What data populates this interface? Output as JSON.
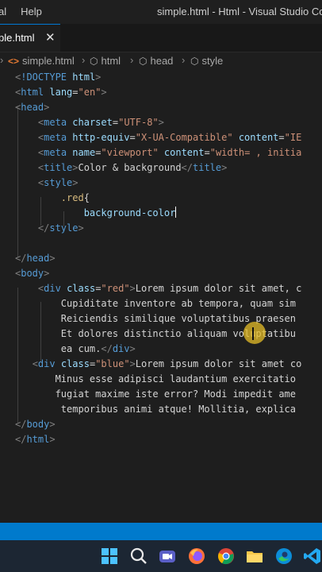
{
  "window": {
    "menu": [
      "al",
      "Help"
    ],
    "title": "simple.html - Html - Visual Studio Code"
  },
  "tab": {
    "label": "ple.html",
    "close": "✕"
  },
  "breadcrumb": [
    "simple.html",
    "html",
    "head",
    "style"
  ],
  "code": [
    [
      [
        "punct",
        "<"
      ],
      [
        "tag",
        "!DOCTYPE"
      ],
      [
        "txt",
        " "
      ],
      [
        "attr",
        "html"
      ],
      [
        "punct",
        ">"
      ]
    ],
    [
      [
        "punct",
        "<"
      ],
      [
        "tag",
        "html"
      ],
      [
        "txt",
        " "
      ],
      [
        "attr",
        "lang"
      ],
      [
        "txt",
        "="
      ],
      [
        "str",
        "\"en\""
      ],
      [
        "punct",
        ">"
      ]
    ],
    [
      [
        "punct",
        "<"
      ],
      [
        "tag",
        "head"
      ],
      [
        "punct",
        ">"
      ]
    ],
    [
      [
        "txt",
        "    "
      ],
      [
        "punct",
        "<"
      ],
      [
        "tag",
        "meta"
      ],
      [
        "txt",
        " "
      ],
      [
        "attr",
        "charset"
      ],
      [
        "txt",
        "="
      ],
      [
        "str",
        "\"UTF-8\""
      ],
      [
        "punct",
        ">"
      ]
    ],
    [
      [
        "txt",
        "    "
      ],
      [
        "punct",
        "<"
      ],
      [
        "tag",
        "meta"
      ],
      [
        "txt",
        " "
      ],
      [
        "attr",
        "http-equiv"
      ],
      [
        "txt",
        "="
      ],
      [
        "str",
        "\"X-UA-Compatible\""
      ],
      [
        "txt",
        " "
      ],
      [
        "attr",
        "content"
      ],
      [
        "txt",
        "="
      ],
      [
        "str",
        "\"IE"
      ]
    ],
    [
      [
        "txt",
        "    "
      ],
      [
        "punct",
        "<"
      ],
      [
        "tag",
        "meta"
      ],
      [
        "txt",
        " "
      ],
      [
        "attr",
        "name"
      ],
      [
        "txt",
        "="
      ],
      [
        "str",
        "\"viewport\""
      ],
      [
        "txt",
        " "
      ],
      [
        "attr",
        "content"
      ],
      [
        "txt",
        "="
      ],
      [
        "str",
        "\"width= , initia"
      ]
    ],
    [
      [
        "txt",
        "    "
      ],
      [
        "punct",
        "<"
      ],
      [
        "tag",
        "title"
      ],
      [
        "punct",
        ">"
      ],
      [
        "txt",
        "Color & background"
      ],
      [
        "punct",
        "</"
      ],
      [
        "tag",
        "title"
      ],
      [
        "punct",
        ">"
      ]
    ],
    [
      [
        "txt",
        "    "
      ],
      [
        "punct",
        "<"
      ],
      [
        "tag",
        "style"
      ],
      [
        "punct",
        ">"
      ]
    ],
    [
      [
        "txt",
        "        "
      ],
      [
        "sel",
        ".red"
      ],
      [
        "txt",
        "{"
      ]
    ],
    [
      [
        "txt",
        "            "
      ],
      [
        "prop",
        "background-color"
      ],
      [
        "cursor",
        ""
      ]
    ],
    [
      [
        "txt",
        "    "
      ],
      [
        "punct",
        "</"
      ],
      [
        "tag",
        "style"
      ],
      [
        "punct",
        ">"
      ]
    ],
    [],
    [
      [
        "punct",
        "</"
      ],
      [
        "tag",
        "head"
      ],
      [
        "punct",
        ">"
      ]
    ],
    [
      [
        "punct",
        "<"
      ],
      [
        "tag",
        "body"
      ],
      [
        "punct",
        ">"
      ]
    ],
    [
      [
        "txt",
        "    "
      ],
      [
        "punct",
        "<"
      ],
      [
        "tag",
        "div"
      ],
      [
        "txt",
        " "
      ],
      [
        "attr",
        "class"
      ],
      [
        "txt",
        "="
      ],
      [
        "str",
        "\"red\""
      ],
      [
        "punct",
        ">"
      ],
      [
        "txt",
        "Lorem ipsum dolor sit amet, c"
      ]
    ],
    [
      [
        "txt",
        "        Cupiditate inventore ab tempora, quam sim"
      ]
    ],
    [
      [
        "txt",
        "        Reiciendis similique voluptatibus praesen"
      ]
    ],
    [
      [
        "txt",
        "        Et dolores distinctio aliquam voluptatibu"
      ]
    ],
    [
      [
        "txt",
        "        ea cum."
      ],
      [
        "punct",
        "</"
      ],
      [
        "tag",
        "div"
      ],
      [
        "punct",
        ">"
      ]
    ],
    [
      [
        "txt",
        "   "
      ],
      [
        "punct",
        "<"
      ],
      [
        "tag",
        "div"
      ],
      [
        "txt",
        " "
      ],
      [
        "attr",
        "class"
      ],
      [
        "txt",
        "="
      ],
      [
        "str",
        "\"blue\""
      ],
      [
        "punct",
        ">"
      ],
      [
        "txt",
        "Lorem ipsum dolor sit amet co"
      ]
    ],
    [
      [
        "txt",
        "       Minus esse adipisci laudantium exercitatio"
      ]
    ],
    [
      [
        "txt",
        "       fugiat maxime iste error? Modi impedit ame"
      ]
    ],
    [
      [
        "txt",
        "        temporibus animi atque! Mollitia, explica"
      ]
    ],
    [
      [
        "punct",
        "</"
      ],
      [
        "tag",
        "body"
      ],
      [
        "punct",
        ">"
      ]
    ],
    [
      [
        "punct",
        "</"
      ],
      [
        "tag",
        "html"
      ],
      [
        "punct",
        ">"
      ]
    ]
  ],
  "taskbar_icons": [
    "windows-start-icon",
    "search-icon",
    "video-call-icon",
    "firefox-icon",
    "chrome-icon",
    "file-explorer-icon",
    "edge-icon",
    "vscode-icon"
  ]
}
